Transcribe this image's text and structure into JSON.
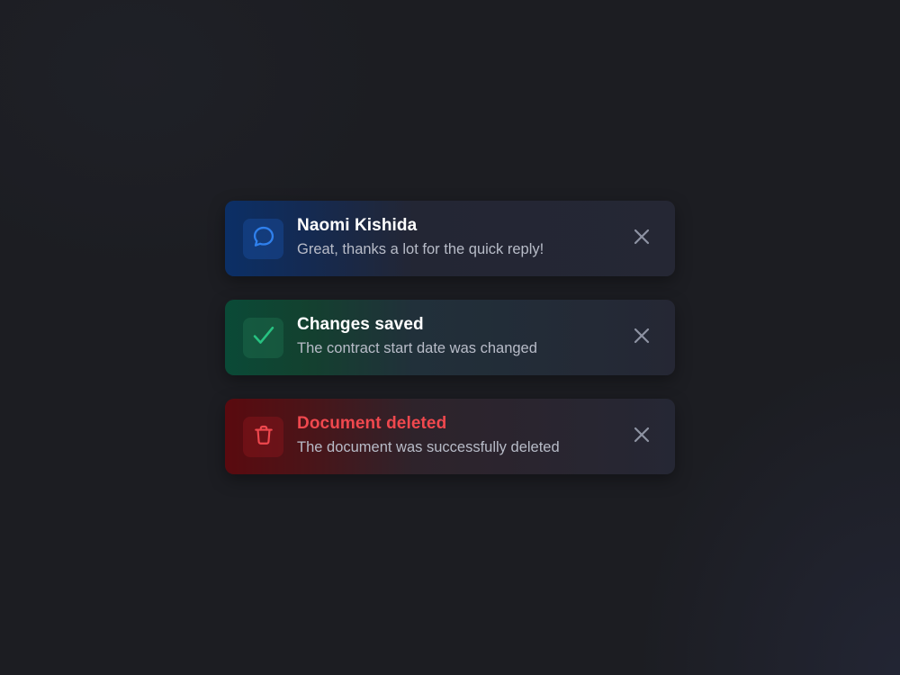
{
  "toasts": [
    {
      "variant": "info",
      "icon": "chat-bubble-icon",
      "title": "Naomi Kishida",
      "message": "Great, thanks a lot for the quick reply!",
      "accent": "#2f80ed"
    },
    {
      "variant": "success",
      "icon": "check-icon",
      "title": "Changes saved",
      "message": "The contract start date was changed",
      "accent": "#27c281"
    },
    {
      "variant": "error",
      "icon": "trash-icon",
      "title": "Document deleted",
      "message": "The document was successfully deleted",
      "accent": "#f0484e"
    }
  ],
  "close_icon": "close-icon",
  "colors": {
    "background": "#1c1d22",
    "toast_surface": "#252734",
    "close_icon": "#8e93a3"
  }
}
